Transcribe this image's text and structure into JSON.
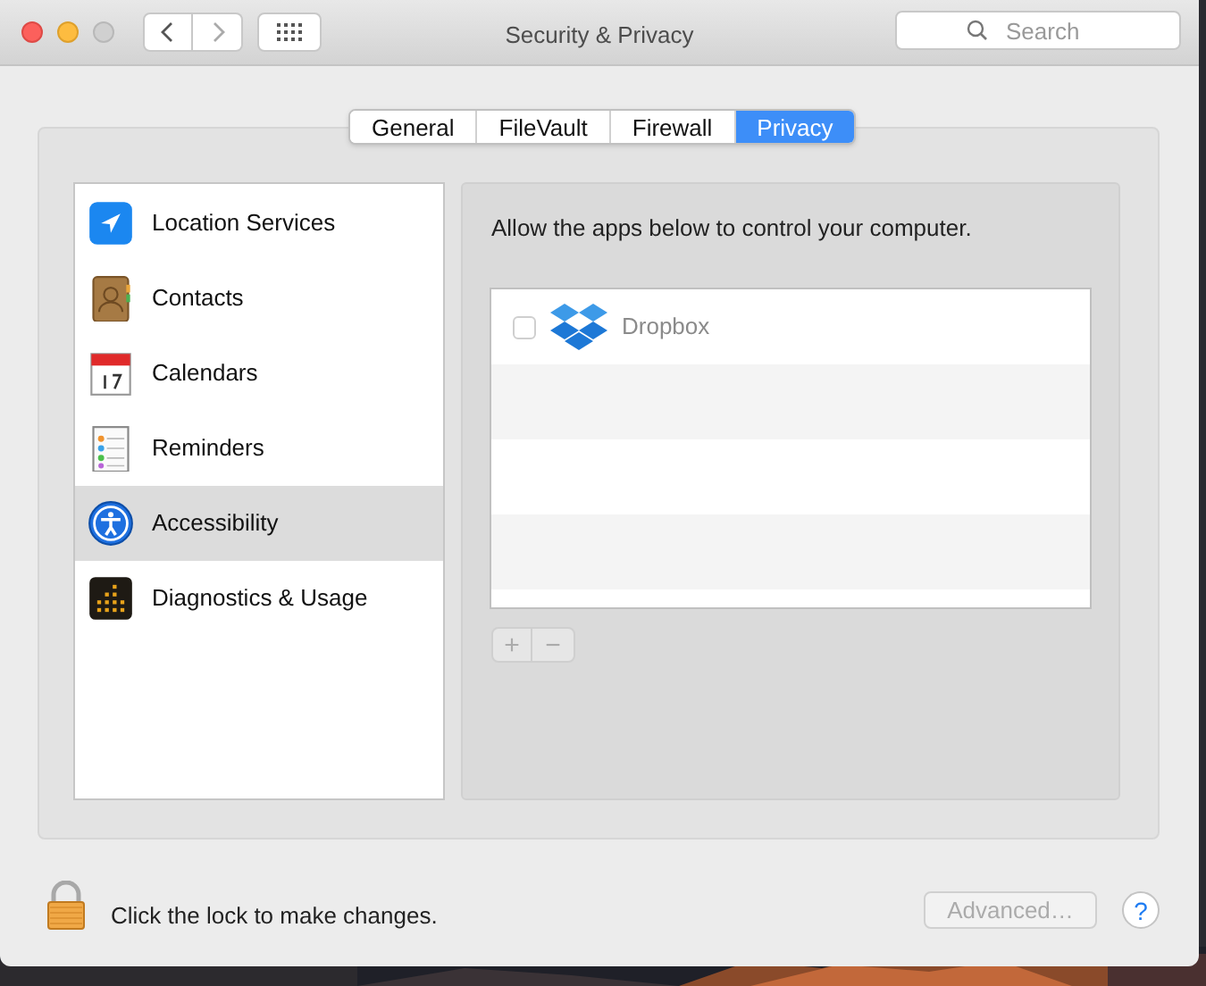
{
  "window": {
    "title": "Security & Privacy"
  },
  "toolbar": {
    "search": {
      "placeholder": "Search"
    }
  },
  "tabs": [
    {
      "label": "General",
      "selected": false
    },
    {
      "label": "FileVault",
      "selected": false
    },
    {
      "label": "Firewall",
      "selected": false
    },
    {
      "label": "Privacy",
      "selected": true
    }
  ],
  "sidebar": {
    "items": [
      {
        "label": "Location Services",
        "kind": "location",
        "selected": false
      },
      {
        "label": "Contacts",
        "kind": "contacts",
        "selected": false
      },
      {
        "label": "Calendars",
        "kind": "calendar",
        "selected": false
      },
      {
        "label": "Reminders",
        "kind": "reminders",
        "selected": false
      },
      {
        "label": "Accessibility",
        "kind": "accessibility",
        "selected": true
      },
      {
        "label": "Diagnostics & Usage",
        "kind": "diagnostics",
        "selected": false
      }
    ]
  },
  "detail": {
    "description": "Allow the apps below to control your computer.",
    "apps": [
      {
        "name": "Dropbox",
        "checked": false,
        "disabled": true
      }
    ],
    "add_button": {
      "label": "+",
      "disabled": true
    },
    "remove_button": {
      "label": "−",
      "disabled": true
    }
  },
  "footer": {
    "lock_text": "Click the lock to make changes.",
    "advanced_button": {
      "label": "Advanced…",
      "disabled": true
    },
    "help_button": {
      "label": "?"
    }
  }
}
